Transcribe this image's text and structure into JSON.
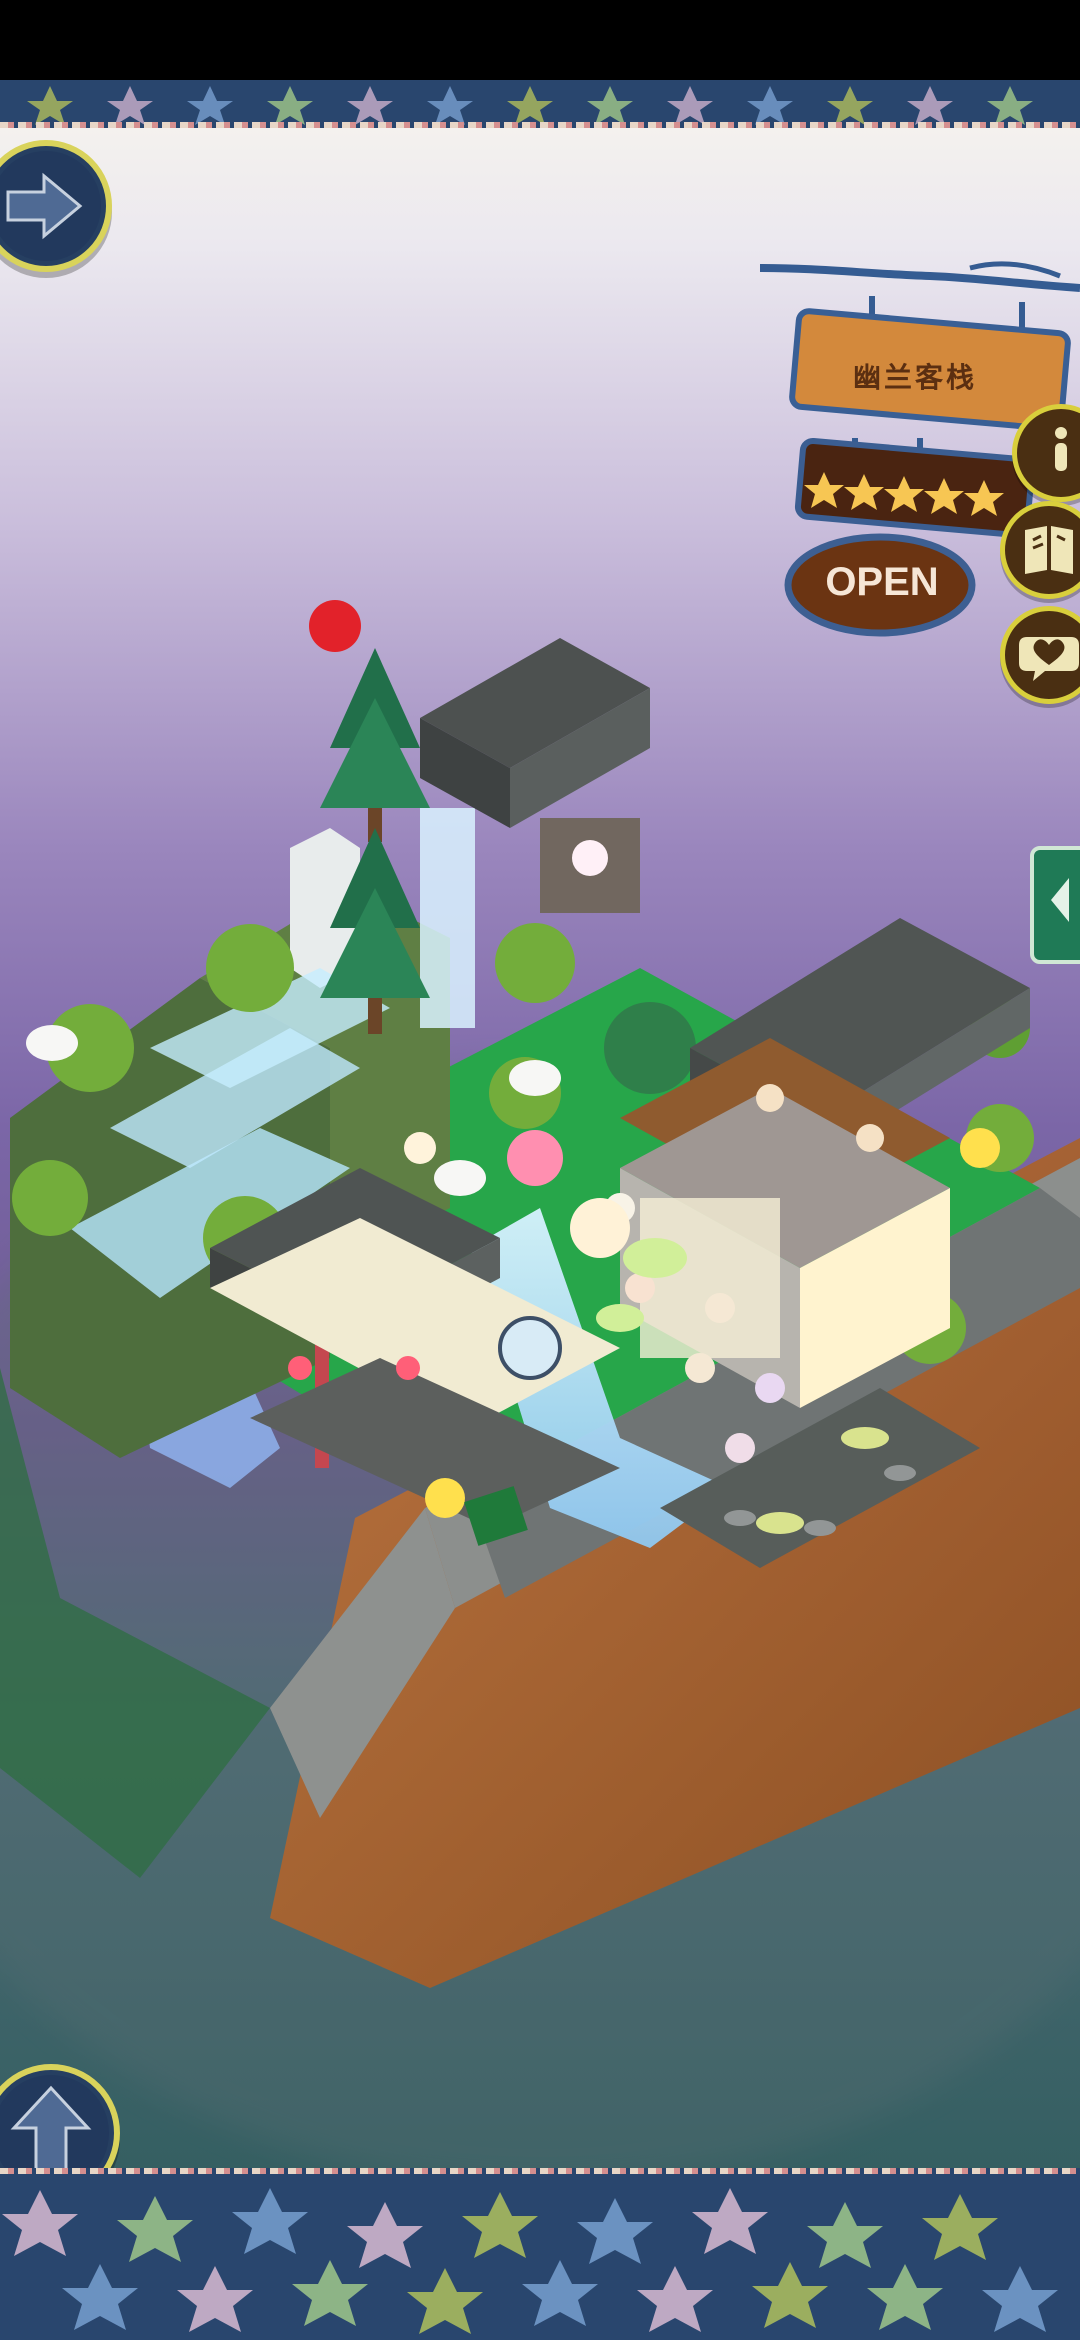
{
  "sign": {
    "title": "幽兰客栈",
    "status": "OPEN",
    "stars": 5
  },
  "scene": {
    "board_text": "",
    "shop_name": ""
  },
  "icons": {
    "left_arrow": "arrow-right-icon",
    "bottom_arrow": "arrow-up-icon",
    "info": "info-icon",
    "book": "book-icon",
    "heart": "heart-chat-icon",
    "side_tab": "chevron-left-icon"
  }
}
